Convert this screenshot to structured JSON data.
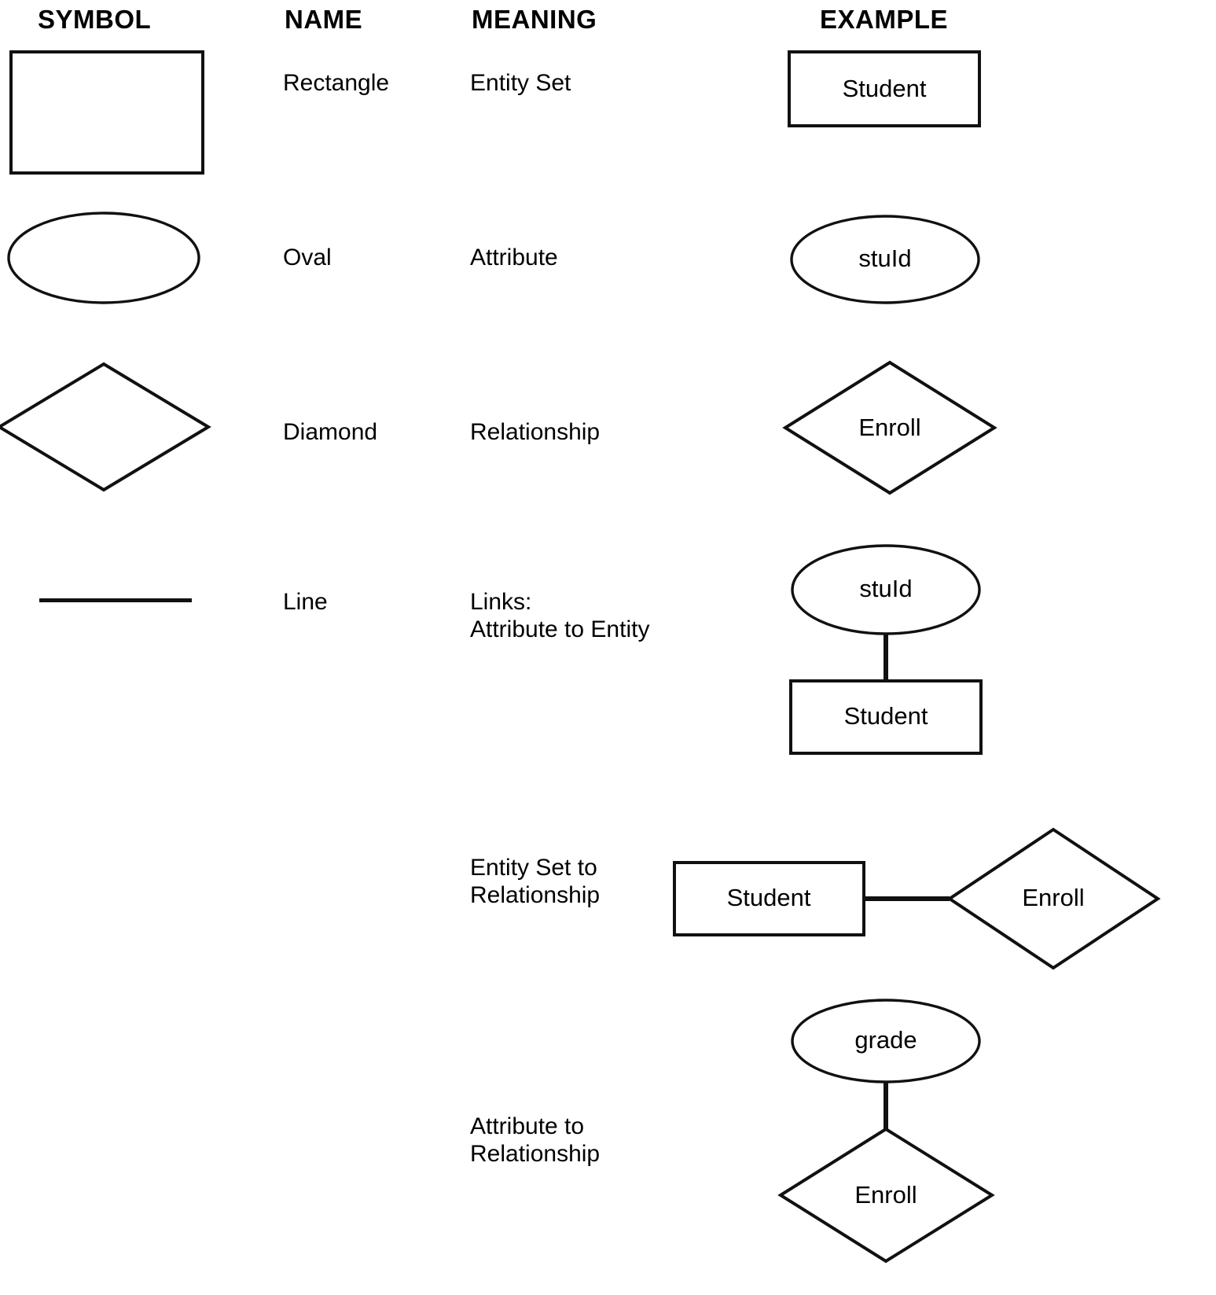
{
  "legend": {
    "headers": {
      "symbol": "SYMBOL",
      "name": "NAME",
      "meaning": "MEANING",
      "example": "EXAMPLE"
    },
    "rows": [
      {
        "symbol_shape": "rectangle",
        "name": "Rectangle",
        "meaning": "Entity Set",
        "example_labels": {
          "entity": "Student"
        }
      },
      {
        "symbol_shape": "oval",
        "name": "Oval",
        "meaning": "Attribute",
        "example_labels": {
          "attribute": "stuId"
        }
      },
      {
        "symbol_shape": "diamond",
        "name": "Diamond",
        "meaning": "Relationship",
        "example_labels": {
          "relationship": "Enroll"
        }
      },
      {
        "symbol_shape": "line",
        "name": "Line",
        "meaning": "Links:\nAttribute to Entity",
        "example_labels": {
          "attribute": "stuId",
          "entity": "Student"
        }
      },
      {
        "symbol_shape": "",
        "name": "",
        "meaning": "Entity Set to\nRelationship",
        "example_labels": {
          "entity": "Student",
          "relationship": "Enroll"
        }
      },
      {
        "symbol_shape": "",
        "name": "",
        "meaning": "Attribute to\nRelationship",
        "example_labels": {
          "attribute": "grade",
          "relationship": "Enroll"
        }
      }
    ]
  },
  "colors": {
    "ink": "#111111",
    "background": "#ffffff"
  }
}
